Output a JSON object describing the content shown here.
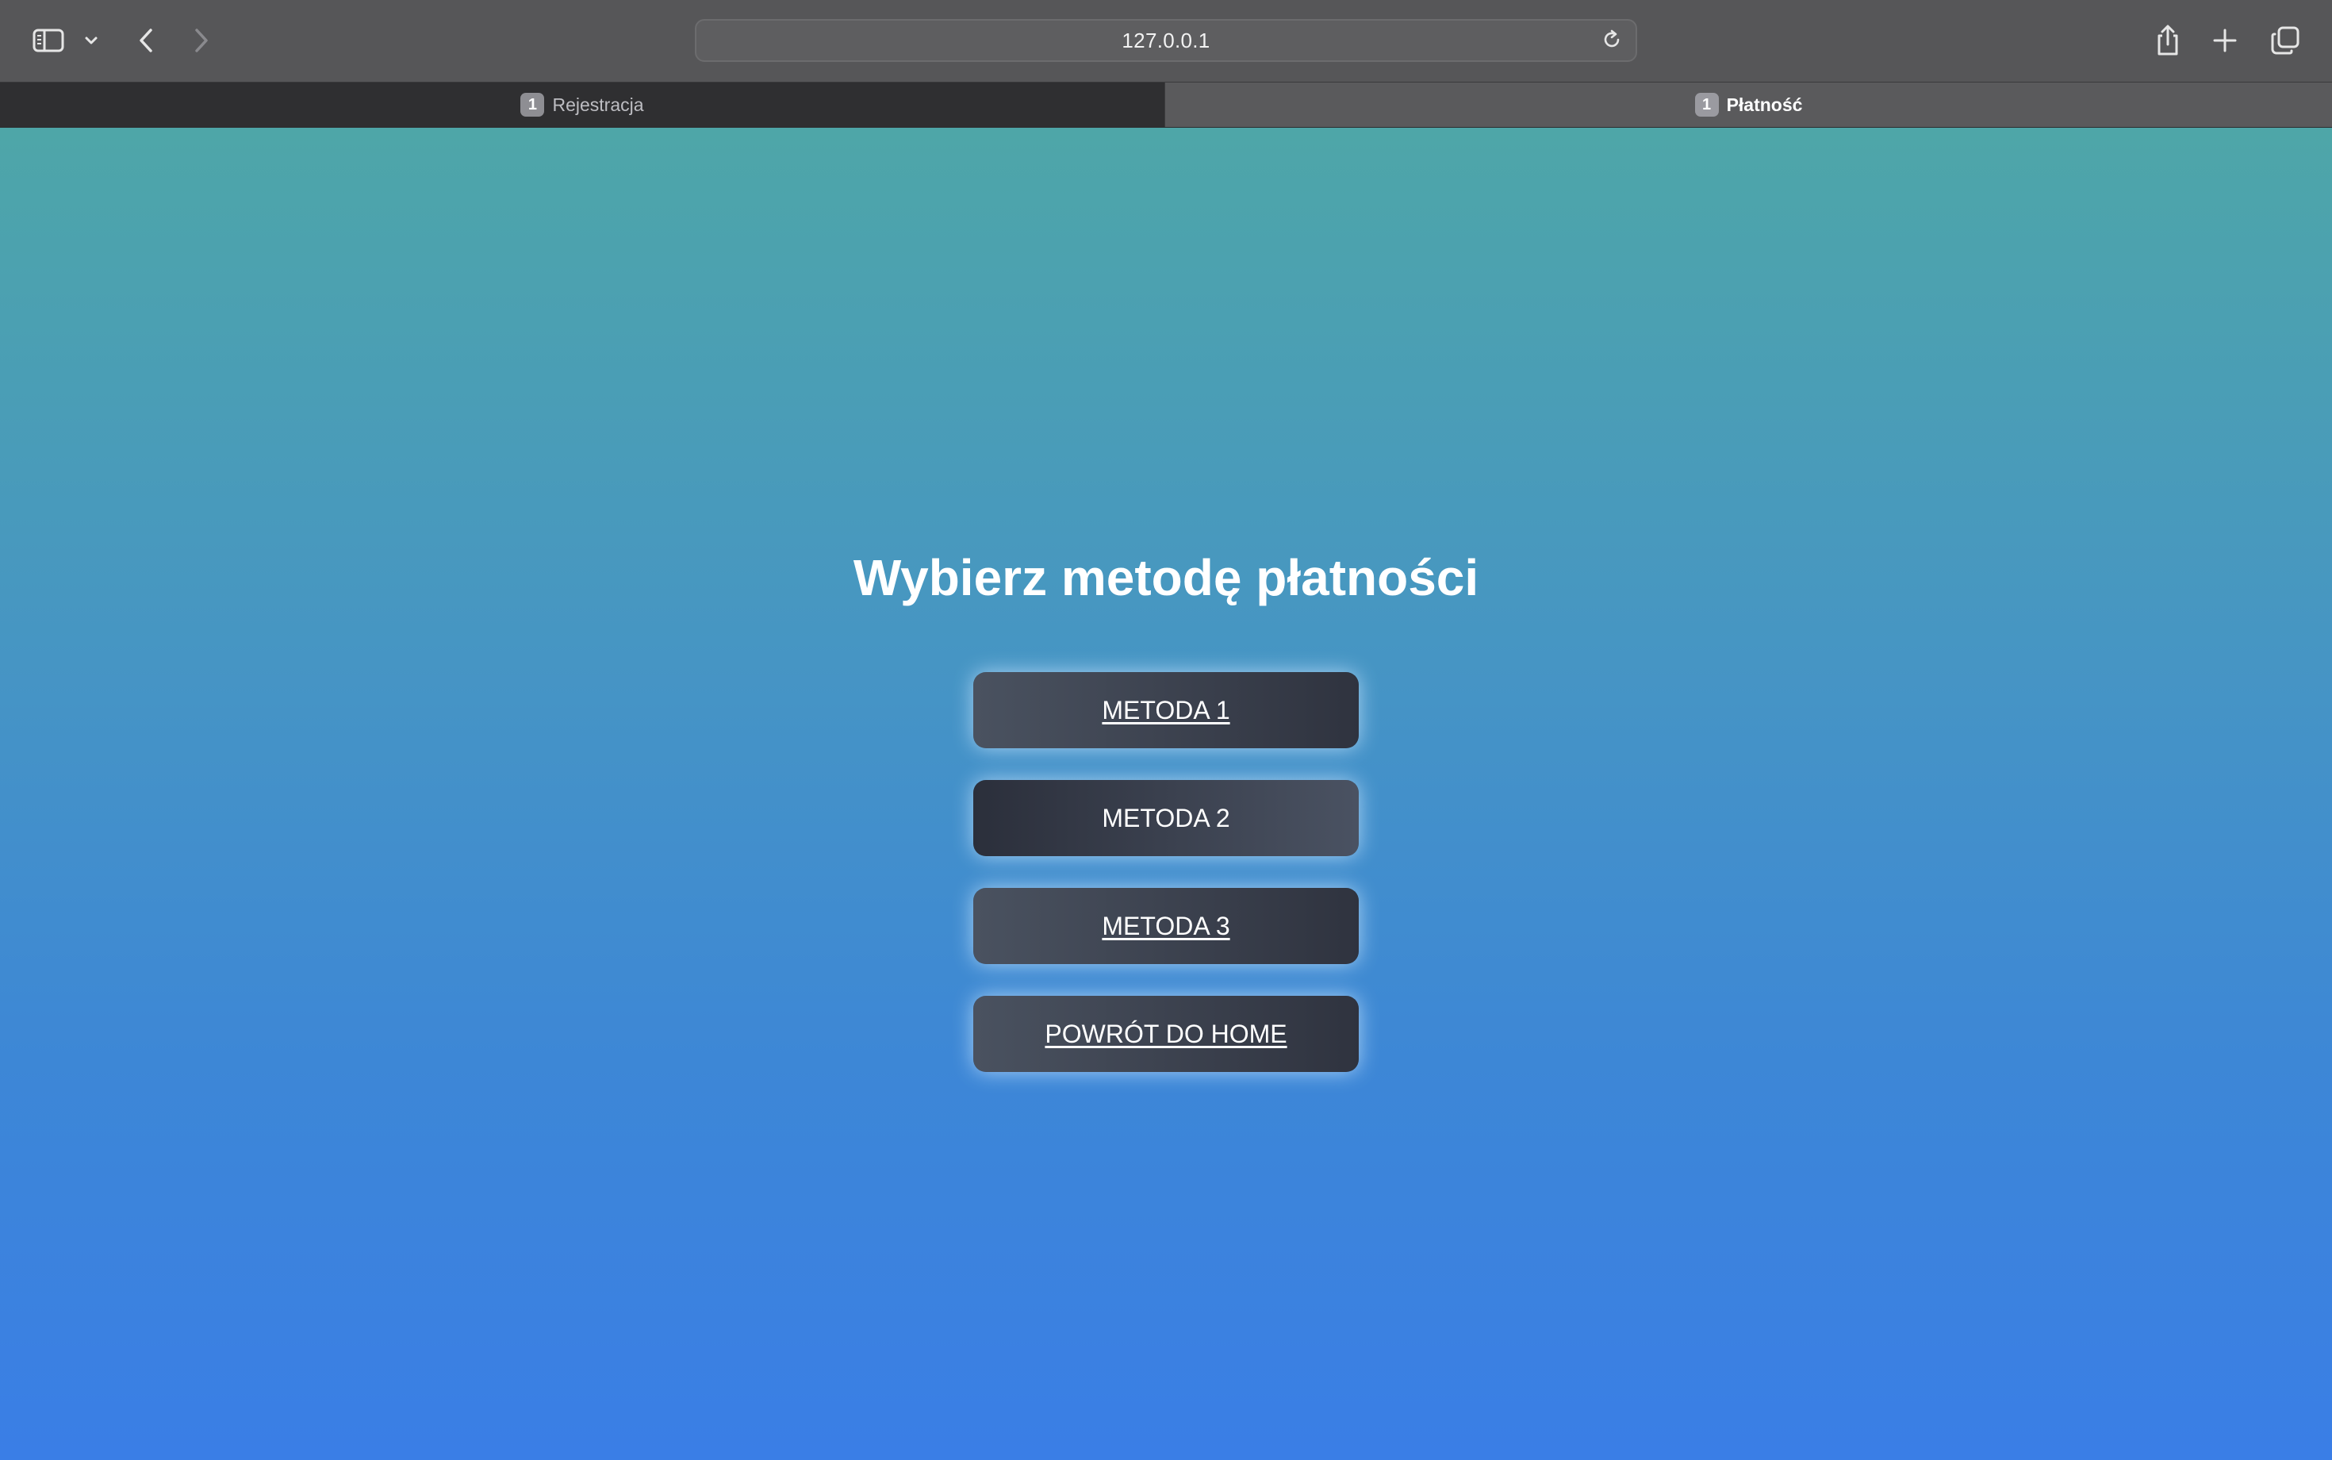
{
  "browser": {
    "address": "127.0.0.1",
    "toolbar_icons": {
      "sidebar": "sidebar-icon",
      "sidebar_menu": "chevron-down-icon",
      "back": "chevron-left-icon",
      "forward": "chevron-right-icon",
      "reload": "reload-icon",
      "share": "share-icon",
      "new_tab": "plus-icon",
      "tab_overview": "tabs-overview-icon"
    },
    "tabs": [
      {
        "badge": "1",
        "label": "Rejestracja",
        "active": false
      },
      {
        "badge": "1",
        "label": "Płatność",
        "active": true
      }
    ]
  },
  "page": {
    "title": "Wybierz metodę płatności",
    "buttons": [
      {
        "label": "METODA 1"
      },
      {
        "label": "METODA 2"
      },
      {
        "label": "METODA 3"
      },
      {
        "label": "POWRÓT DO HOME"
      }
    ]
  },
  "colors": {
    "gradient_top": "#4ea6a8",
    "gradient_bottom": "#3a7ee6",
    "button_dark": "#2b2f3b",
    "button_light": "#4a5260",
    "toolbar": "#565658"
  }
}
